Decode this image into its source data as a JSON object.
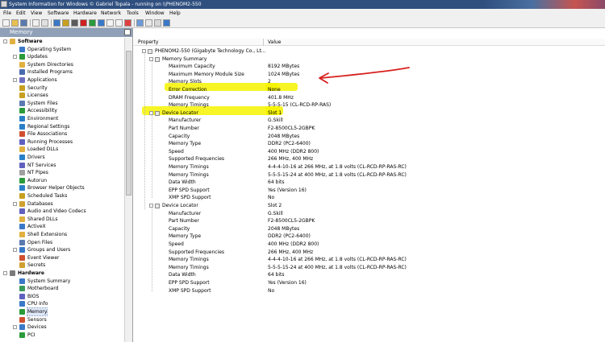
{
  "window": {
    "title": "System Information for Windows  © Gabriel Topala - running on \\\\PHENOM2-550"
  },
  "menu": [
    "File",
    "Edit",
    "View",
    "Software",
    "Hardware",
    "Network",
    "Tools",
    "Window",
    "Help"
  ],
  "left_pane": {
    "title": "Memory",
    "tree": [
      {
        "label": "Software",
        "level": 0,
        "category": true,
        "expander": true,
        "icon": "folder-icon",
        "color": "#e0b040"
      },
      {
        "label": "Operating System",
        "level": 1,
        "icon": "windows-icon",
        "color": "#3a78c8"
      },
      {
        "label": "Updates",
        "level": 1,
        "expander": true,
        "icon": "updates-icon",
        "color": "#2a9a3a"
      },
      {
        "label": "System Directories",
        "level": 1,
        "icon": "folder-icon",
        "color": "#e0b040"
      },
      {
        "label": "Installed Programs",
        "level": 1,
        "icon": "programs-icon",
        "color": "#4a6ab0"
      },
      {
        "label": "Applications",
        "level": 1,
        "expander": true,
        "icon": "applications-icon",
        "color": "#7070c0"
      },
      {
        "label": "Security",
        "level": 1,
        "icon": "security-icon",
        "color": "#c8a020"
      },
      {
        "label": "Licenses",
        "level": 1,
        "icon": "license-icon",
        "color": "#c8a020"
      },
      {
        "label": "System Files",
        "level": 1,
        "icon": "file-icon",
        "color": "#5a7ab0"
      },
      {
        "label": "Accessibility",
        "level": 1,
        "icon": "accessibility-icon",
        "color": "#2a9a3a"
      },
      {
        "label": "Environment",
        "level": 1,
        "icon": "environment-icon",
        "color": "#2a80c8"
      },
      {
        "label": "Regional Settings",
        "level": 1,
        "icon": "regional-icon",
        "color": "#2a80c8"
      },
      {
        "label": "File Associations",
        "level": 1,
        "icon": "association-icon",
        "color": "#d05030"
      },
      {
        "label": "Running Processes",
        "level": 1,
        "icon": "process-icon",
        "color": "#6060c0"
      },
      {
        "label": "Loaded DLLs",
        "level": 1,
        "icon": "dll-icon",
        "color": "#e0b040"
      },
      {
        "label": "Drivers",
        "level": 1,
        "icon": "driver-icon",
        "color": "#2a80c8"
      },
      {
        "label": "NT Services",
        "level": 1,
        "icon": "services-icon",
        "color": "#6060c0"
      },
      {
        "label": "NT Pipes",
        "level": 1,
        "icon": "pipes-icon",
        "color": "#a0a0a0"
      },
      {
        "label": "Autorun",
        "level": 1,
        "icon": "autorun-icon",
        "color": "#2a9a3a"
      },
      {
        "label": "Browser Helper Objects",
        "level": 1,
        "icon": "browser-icon",
        "color": "#2a80c8"
      },
      {
        "label": "Scheduled Tasks",
        "level": 1,
        "icon": "tasks-icon",
        "color": "#c8a020"
      },
      {
        "label": "Databases",
        "level": 1,
        "expander": true,
        "icon": "database-icon",
        "color": "#d0a030"
      },
      {
        "label": "Audio and Video Codecs",
        "level": 1,
        "icon": "codec-icon",
        "color": "#6060c0"
      },
      {
        "label": "Shared DLLs",
        "level": 1,
        "icon": "dll-icon",
        "color": "#e0b040"
      },
      {
        "label": "ActiveX",
        "level": 1,
        "icon": "activex-icon",
        "color": "#3a78c8"
      },
      {
        "label": "Shell Extensions",
        "level": 1,
        "icon": "shell-icon",
        "color": "#e0b040"
      },
      {
        "label": "Open Files",
        "level": 1,
        "icon": "file-icon",
        "color": "#5a7ab0"
      },
      {
        "label": "Groups and Users",
        "level": 1,
        "expander": true,
        "icon": "users-icon",
        "color": "#3a78c8"
      },
      {
        "label": "Event Viewer",
        "level": 1,
        "icon": "event-icon",
        "color": "#d05030"
      },
      {
        "label": "Secrets",
        "level": 1,
        "icon": "key-icon",
        "color": "#d0a030"
      },
      {
        "label": "Hardware",
        "level": 0,
        "category": true,
        "expander": true,
        "icon": "hardware-icon",
        "color": "#7a7a7a"
      },
      {
        "label": "System Summary",
        "level": 1,
        "icon": "summary-icon",
        "color": "#3a78c8"
      },
      {
        "label": "Motherboard",
        "level": 1,
        "icon": "motherboard-icon",
        "color": "#3a9a5a"
      },
      {
        "label": "BIOS",
        "level": 1,
        "icon": "bios-icon",
        "color": "#6060c0"
      },
      {
        "label": "CPU Info",
        "level": 1,
        "icon": "cpu-icon",
        "color": "#3a78c8"
      },
      {
        "label": "Memory",
        "level": 1,
        "icon": "memory-icon",
        "color": "#2a9a3a",
        "selected": true
      },
      {
        "label": "Sensors",
        "level": 1,
        "icon": "sensor-icon",
        "color": "#d05030"
      },
      {
        "label": "Devices",
        "level": 1,
        "expander": true,
        "icon": "devices-icon",
        "color": "#3a78c8"
      },
      {
        "label": "PCI",
        "level": 1,
        "icon": "pci-icon",
        "color": "#2a9a3a"
      }
    ]
  },
  "grid": {
    "col_property": "Property",
    "col_value": "Value",
    "rows": [
      {
        "p": "PHENOM2-550 (Gigabyte Technology Co., Lt...",
        "v": "",
        "level": 0,
        "expander": true,
        "icon": "computer-icon"
      },
      {
        "p": "Memory Summary",
        "v": "",
        "level": 1,
        "expander": true,
        "icon": "memory-icon"
      },
      {
        "p": "Maximum Capacity",
        "v": "8192 MBytes",
        "level": 2
      },
      {
        "p": "Maximum Memory Module Size",
        "v": "1024 MBytes",
        "level": 2
      },
      {
        "p": "Memory Slots",
        "v": "2",
        "level": 2
      },
      {
        "p": "Error Correction",
        "v": "None",
        "level": 2
      },
      {
        "p": "DRAM Frequency",
        "v": "401.8 MHz",
        "level": 2
      },
      {
        "p": "Memory Timings",
        "v": "5-5-5-15 (CL-RCD-RP-RAS)",
        "level": 2
      },
      {
        "p": "Device Locator",
        "v": "Slot 1",
        "level": 1,
        "expander": true,
        "icon": "memory-icon"
      },
      {
        "p": "Manufacturer",
        "v": "G.Skill",
        "level": 2
      },
      {
        "p": "Part Number",
        "v": "F2-8500CL5-2GBPK",
        "level": 2
      },
      {
        "p": "Capacity",
        "v": "2048 MBytes",
        "level": 2
      },
      {
        "p": "Memory Type",
        "v": "DDR2 (PC2-6400)",
        "level": 2
      },
      {
        "p": "Speed",
        "v": "400 MHz (DDR2 800)",
        "level": 2
      },
      {
        "p": "Supported Frequencies",
        "v": "266 MHz, 400 MHz",
        "level": 2
      },
      {
        "p": "Memory Timings",
        "v": "4-4-4-10-16 at 266 MHz, at 1.8 volts (CL-RCD-RP-RAS-RC)",
        "level": 2
      },
      {
        "p": "Memory Timings",
        "v": "5-5-5-15-24 at 400 MHz, at 1.8 volts (CL-RCD-RP-RAS-RC)",
        "level": 2
      },
      {
        "p": "Data Width",
        "v": "64 bits",
        "level": 2
      },
      {
        "p": "EPP SPD Support",
        "v": "Yes (Version 16)",
        "level": 2
      },
      {
        "p": "XMP SPD Support",
        "v": "No",
        "level": 2
      },
      {
        "p": "Device Locator",
        "v": "Slot 2",
        "level": 1,
        "expander": true,
        "icon": "memory-icon"
      },
      {
        "p": "Manufacturer",
        "v": "G.Skill",
        "level": 2
      },
      {
        "p": "Part Number",
        "v": "F2-8500CL5-2GBPK",
        "level": 2
      },
      {
        "p": "Capacity",
        "v": "2048 MBytes",
        "level": 2
      },
      {
        "p": "Memory Type",
        "v": "DDR2 (PC2-6400)",
        "level": 2
      },
      {
        "p": "Speed",
        "v": "400 MHz (DDR2 800)",
        "level": 2
      },
      {
        "p": "Supported Frequencies",
        "v": "266 MHz, 400 MHz",
        "level": 2
      },
      {
        "p": "Memory Timings",
        "v": "4-4-4-10-16 at 266 MHz, at 1.8 volts (CL-RCD-RP-RAS-RC)",
        "level": 2
      },
      {
        "p": "Memory Timings",
        "v": "5-5-5-15-24 at 400 MHz, at 1.8 volts (CL-RCD-RP-RAS-RC)",
        "level": 2
      },
      {
        "p": "Data Width",
        "v": "64 bits",
        "level": 2
      },
      {
        "p": "EPP SPD Support",
        "v": "Yes (Version 16)",
        "level": 2
      },
      {
        "p": "XMP SPD Support",
        "v": "No",
        "level": 2
      }
    ]
  },
  "annotation": {
    "highlight_color": "#f6f300",
    "arrow_color": "#d8201c"
  }
}
